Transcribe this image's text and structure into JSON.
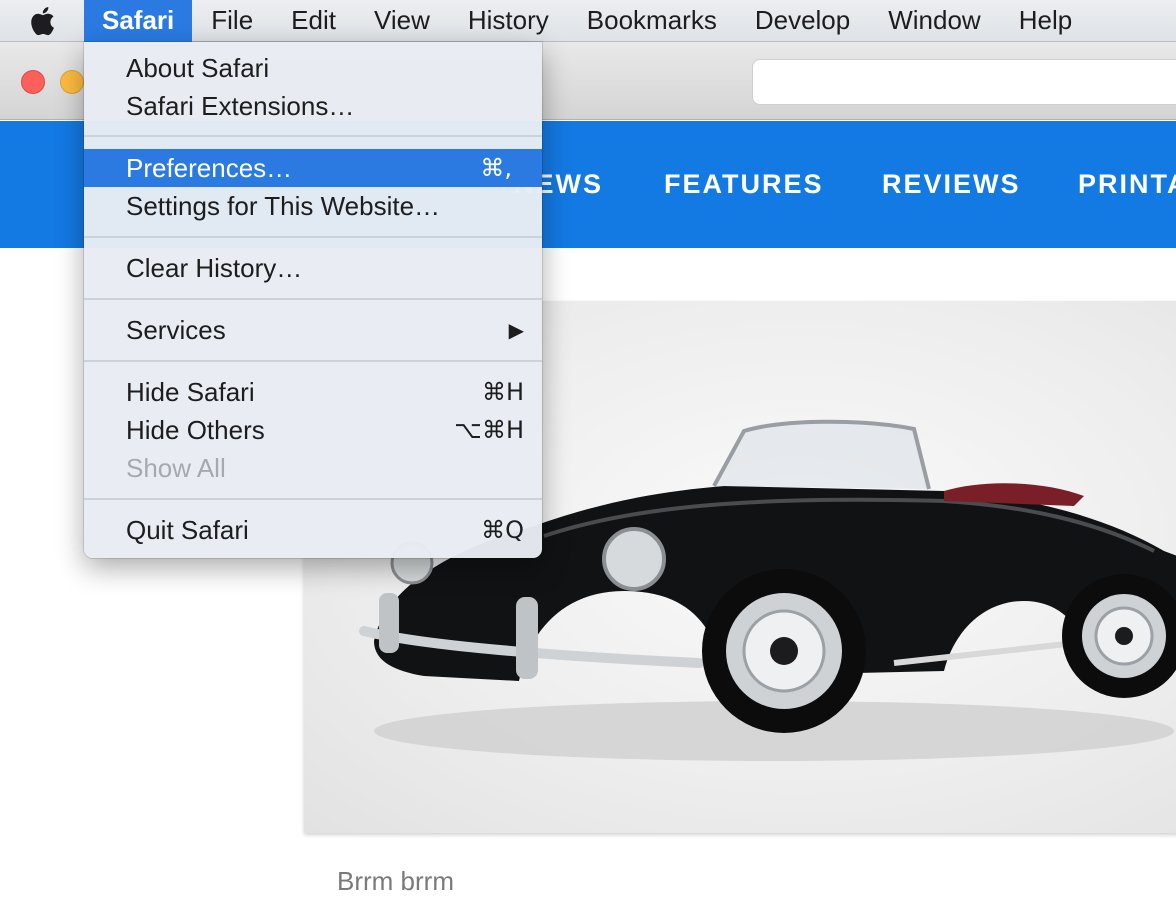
{
  "menubar": {
    "apple_icon": "apple-logo-icon",
    "active_menu": "Safari",
    "items": [
      "File",
      "Edit",
      "View",
      "History",
      "Bookmarks",
      "Develop",
      "Window",
      "Help"
    ]
  },
  "safari_menu": {
    "about": "About Safari",
    "extensions": "Safari Extensions…",
    "preferences": "Preferences…",
    "preferences_shortcut": "⌘,",
    "settings_site": "Settings for This Website…",
    "clear_history": "Clear History…",
    "services": "Services",
    "services_arrow": "▶",
    "hide_safari": "Hide Safari",
    "hide_safari_shortcut": "⌘H",
    "hide_others": "Hide Others",
    "hide_others_shortcut": "⌥⌘H",
    "show_all": "Show All",
    "quit": "Quit Safari",
    "quit_shortcut": "⌘Q"
  },
  "site_nav": {
    "news": "NEWS",
    "features": "FEATURES",
    "reviews": "REVIEWS",
    "printables": "PRINTA"
  },
  "article": {
    "image_alt": "Black vintage convertible sports car",
    "caption": "Brrm brrm"
  },
  "colors": {
    "accent": "#2a7ae2",
    "site_nav": "#1379e3"
  }
}
